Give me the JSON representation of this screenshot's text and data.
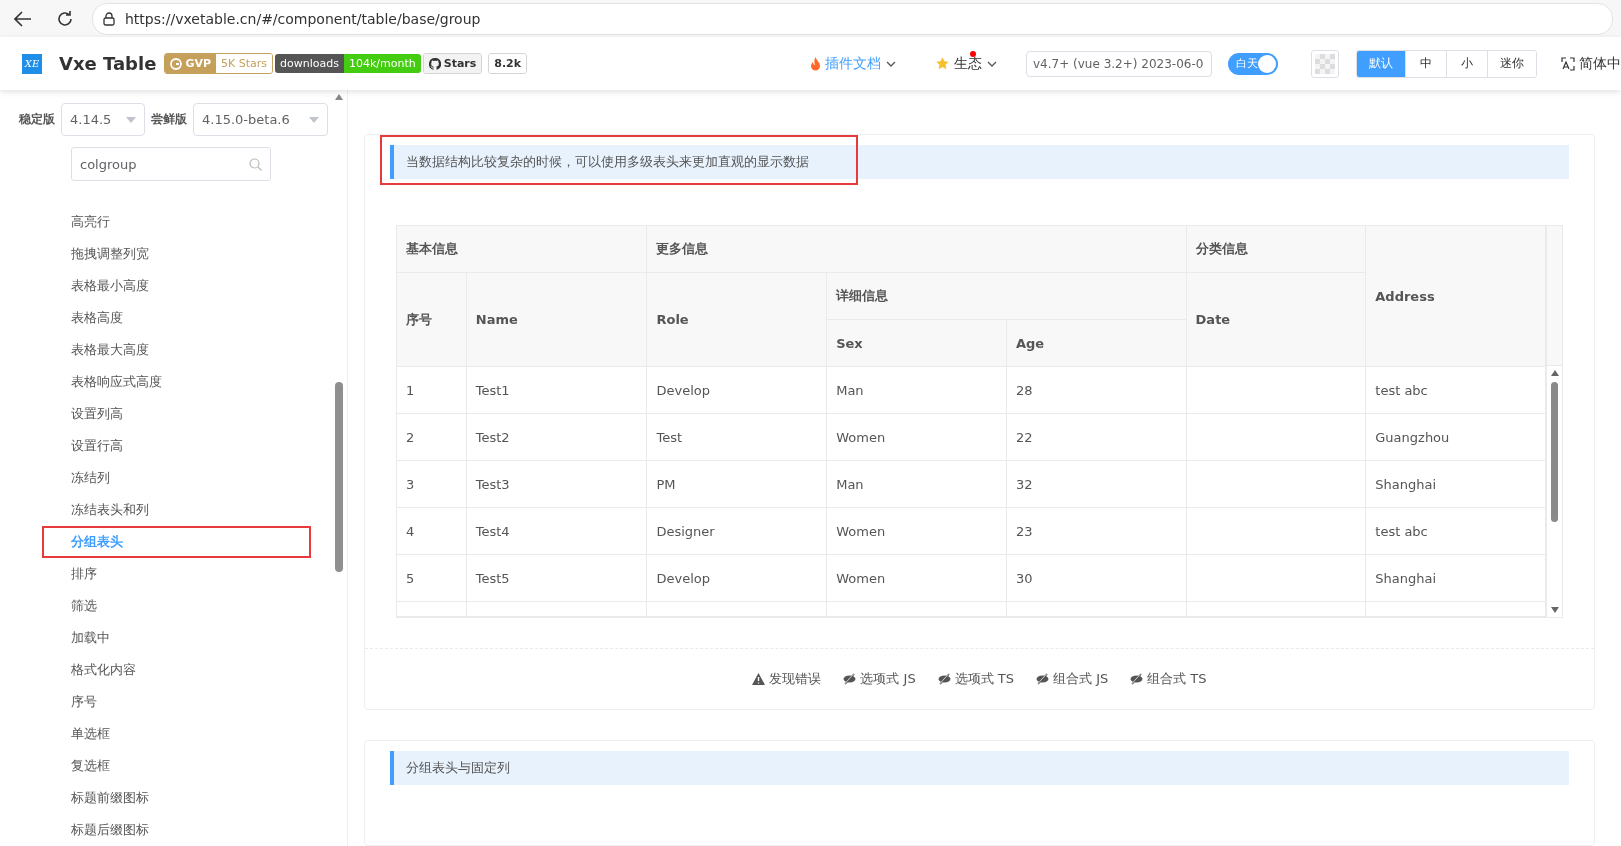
{
  "browser": {
    "url": "https://vxetable.cn/#/component/table/base/group"
  },
  "header": {
    "logo_text": "XE",
    "title": "Vxe Table",
    "badges": [
      {
        "kind": "gvp",
        "label": "GVP",
        "value": "5K Stars"
      },
      {
        "kind": "split",
        "label": "downloads",
        "value": "104k/month"
      },
      {
        "kind": "github",
        "label": "Stars",
        "value": "8.2k"
      }
    ],
    "nav": [
      {
        "kind": "flame",
        "label": "插件文档",
        "dot": false
      },
      {
        "kind": "star",
        "label": "生态",
        "dot": true
      }
    ],
    "version_select": "v4.7+ (vue 3.2+) 2023-06-0",
    "theme_toggle": {
      "label": "白天",
      "on": true
    },
    "sizes": [
      {
        "label": "默认",
        "selected": true
      },
      {
        "label": "中",
        "selected": false
      },
      {
        "label": "小",
        "selected": false
      },
      {
        "label": "迷你",
        "selected": false
      }
    ],
    "language": "简体中"
  },
  "sidebar": {
    "stable_label": "稳定版",
    "stable_value": "4.14.5",
    "preview_label": "尝鲜版",
    "preview_value": "4.15.0-beta.6",
    "search_value": "colgroup",
    "items": [
      {
        "label": "高亮行",
        "selected": false,
        "annotated": false
      },
      {
        "label": "拖拽调整列宽",
        "selected": false,
        "annotated": false
      },
      {
        "label": "表格最小高度",
        "selected": false,
        "annotated": false
      },
      {
        "label": "表格高度",
        "selected": false,
        "annotated": false
      },
      {
        "label": "表格最大高度",
        "selected": false,
        "annotated": false
      },
      {
        "label": "表格响应式高度",
        "selected": false,
        "annotated": false
      },
      {
        "label": "设置列高",
        "selected": false,
        "annotated": false
      },
      {
        "label": "设置行高",
        "selected": false,
        "annotated": false
      },
      {
        "label": "冻结列",
        "selected": false,
        "annotated": false
      },
      {
        "label": "冻结表头和列",
        "selected": false,
        "annotated": false
      },
      {
        "label": "分组表头",
        "selected": true,
        "annotated": true
      },
      {
        "label": "排序",
        "selected": false,
        "annotated": false
      },
      {
        "label": "筛选",
        "selected": false,
        "annotated": false
      },
      {
        "label": "加载中",
        "selected": false,
        "annotated": false
      },
      {
        "label": "格式化内容",
        "selected": false,
        "annotated": false
      },
      {
        "label": "序号",
        "selected": false,
        "annotated": false
      },
      {
        "label": "单选框",
        "selected": false,
        "annotated": false
      },
      {
        "label": "复选框",
        "selected": false,
        "annotated": false
      },
      {
        "label": "标题前缀图标",
        "selected": false,
        "annotated": false
      },
      {
        "label": "标题后缀图标",
        "selected": false,
        "annotated": false
      }
    ]
  },
  "demo": {
    "tip": "当数据结构比较复杂的时候，可以使用多级表头来更加直观的显示数据",
    "tip_annotated": true,
    "table": {
      "header": [
        {
          "label": "基本信息",
          "children": [
            {
              "label": "序号"
            },
            {
              "label": "Name"
            }
          ]
        },
        {
          "label": "更多信息",
          "children": [
            {
              "label": "Role"
            },
            {
              "label": "详细信息",
              "children": [
                {
                  "label": "Sex"
                },
                {
                  "label": "Age"
                }
              ]
            }
          ]
        },
        {
          "label": "分类信息",
          "children": [
            {
              "label": "Date"
            }
          ]
        },
        {
          "label": "Address"
        }
      ],
      "rows": [
        [
          "1",
          "Test1",
          "Develop",
          "Man",
          "28",
          null,
          "test abc"
        ],
        [
          "2",
          "Test2",
          "Test",
          "Women",
          "22",
          null,
          "Guangzhou"
        ],
        [
          "3",
          "Test3",
          "PM",
          "Man",
          "32",
          null,
          "Shanghai"
        ],
        [
          "4",
          "Test4",
          "Designer",
          "Women",
          "23",
          null,
          "test abc"
        ],
        [
          "5",
          "Test5",
          "Develop",
          "Women",
          "30",
          null,
          "Shanghai"
        ]
      ]
    },
    "links": [
      {
        "kind": "warning",
        "label": "发现错误"
      },
      {
        "kind": "hidden",
        "label": "选项式 JS"
      },
      {
        "kind": "hidden",
        "label": "选项式 TS"
      },
      {
        "kind": "hidden",
        "label": "组合式 JS"
      },
      {
        "kind": "hidden",
        "label": "组合式 TS"
      }
    ]
  },
  "next_demo": {
    "tip": "分组表头与固定列"
  }
}
